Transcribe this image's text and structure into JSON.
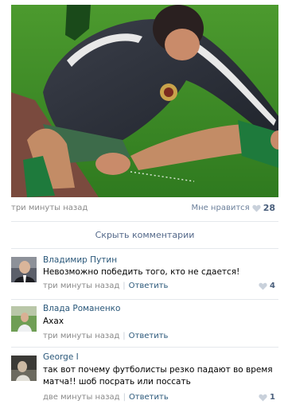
{
  "post": {
    "photo_alt": "photo",
    "time": "три минуты назад",
    "like_label": "Мне нравится",
    "like_count": "28",
    "hide_comments": "Скрыть комментарии"
  },
  "comments": [
    {
      "author": "Владимир Путин",
      "text": "Невозможно победить того, кто не сдается!",
      "time": "три минуты назад",
      "reply": "Ответить",
      "likes": "4"
    },
    {
      "author": "Влада Романенко",
      "text": "Ахах",
      "time": "три минуты назад",
      "reply": "Ответить",
      "likes": ""
    },
    {
      "author": "George I",
      "text": "так вот почему футболисты резко падают во время матча!! шоб посрать или поссать",
      "time": "две минуты назад",
      "reply": "Ответить",
      "likes": "1"
    }
  ],
  "colors": {
    "link": "#2b587a",
    "muted": "#8a8a8a",
    "heart": "#c9d1db",
    "divider": "#e5e8ec"
  },
  "icons": {
    "like": "heart-icon"
  }
}
